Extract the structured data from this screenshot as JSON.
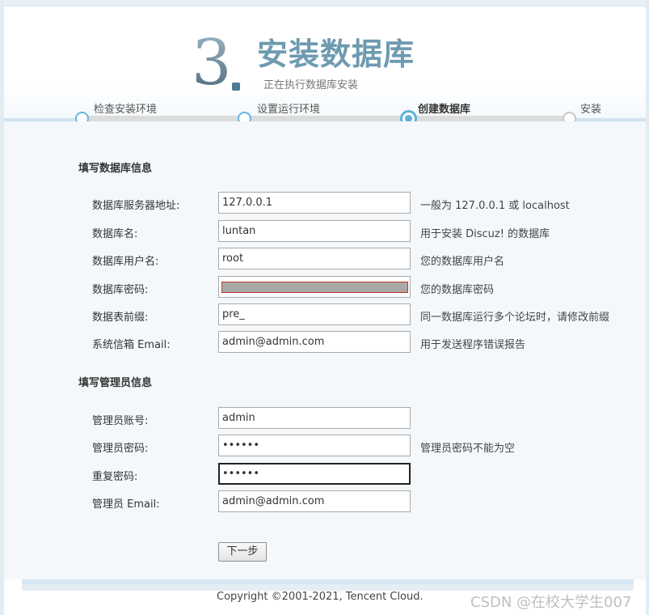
{
  "header": {
    "step_number": "3",
    "title": "安装数据库",
    "subtitle": "正在执行数据库安装"
  },
  "steps": [
    {
      "label": "检查安装环境",
      "state": "done"
    },
    {
      "label": "设置运行环境",
      "state": "done"
    },
    {
      "label": "创建数据库",
      "state": "current"
    },
    {
      "label": "安装",
      "state": "pending"
    }
  ],
  "db_section": {
    "title": "填写数据库信息",
    "fields": [
      {
        "label": "数据库服务器地址:",
        "value": "127.0.0.1",
        "hint": "一般为 127.0.0.1 或 localhost"
      },
      {
        "label": "数据库名:",
        "value": "luntan",
        "hint": "用于安装 Discuz! 的数据库"
      },
      {
        "label": "数据库用户名:",
        "value": "root",
        "hint": "您的数据库用户名"
      },
      {
        "label": "数据库密码:",
        "value": "",
        "hint": "您的数据库密码"
      },
      {
        "label": "数据表前缀:",
        "value": "pre_",
        "hint": "同一数据库运行多个论坛时，请修改前缀"
      },
      {
        "label": "系统信箱 Email:",
        "value": "admin@admin.com",
        "hint": "用于发送程序错误报告"
      }
    ]
  },
  "admin_section": {
    "title": "填写管理员信息",
    "fields": [
      {
        "label": "管理员账号:",
        "value": "admin",
        "hint": ""
      },
      {
        "label": "管理员密码:",
        "value": "••••••",
        "hint": "管理员密码不能为空"
      },
      {
        "label": "重复密码:",
        "value": "••••••",
        "hint": ""
      },
      {
        "label": "管理员 Email:",
        "value": "admin@admin.com",
        "hint": ""
      }
    ]
  },
  "buttons": {
    "next_label": "下一步"
  },
  "footer": {
    "copyright": "Copyright ©2001-2021, Tencent Cloud.",
    "watermark": "CSDN @在校大学生007"
  }
}
